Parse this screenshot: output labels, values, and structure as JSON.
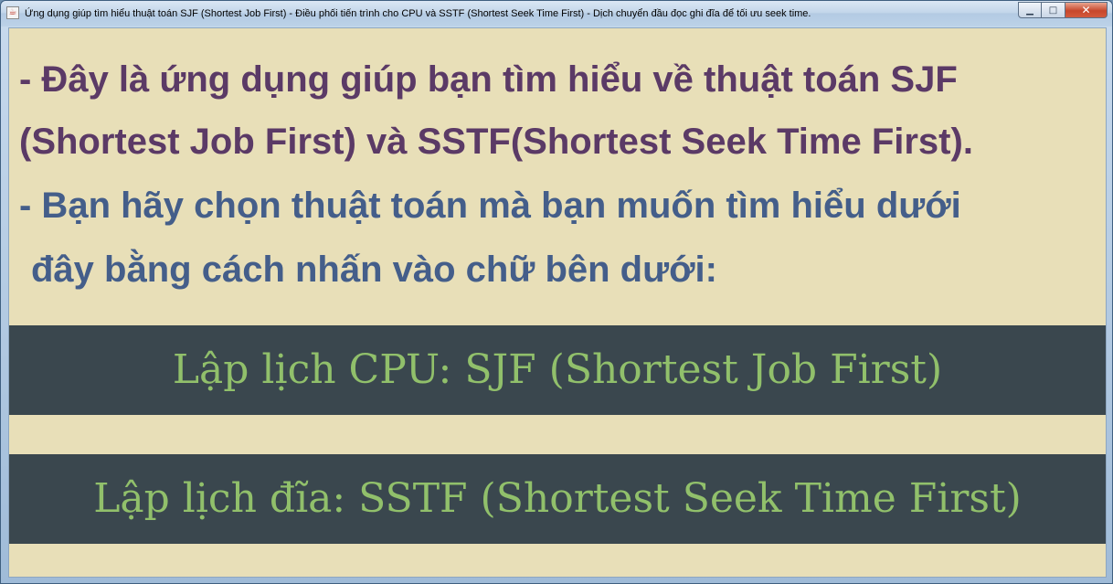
{
  "window": {
    "title": "Ứng dụng giúp tìm hiểu thuật toán SJF (Shortest Job First) - Điều phối tiến trình cho CPU và SSTF (Shortest Seek Time First) - Dịch chuyển đầu đọc ghi đĩa để tối ưu seek time.",
    "icon": "java-app-icon",
    "controls": {
      "minimize": "minimize-icon",
      "maximize": "maximize-icon",
      "close": "close-icon"
    }
  },
  "intro": {
    "line1": "- Đây là ứng dụng giúp bạn tìm hiểu về thuật toán SJF",
    "line2": "(Shortest Job First) và SSTF(Shortest Seek Time First).",
    "line3": "- Bạn hãy chọn thuật toán mà bạn muốn tìm hiểu dưới",
    "line4": "đây bằng cách nhấn vào chữ bên dưới:"
  },
  "options": {
    "cpu_label": "Lập lịch CPU: SJF (Shortest Job First)",
    "disk_label": "Lập lịch đĩa: SSTF (Shortest Seek Time First)"
  },
  "colors": {
    "background": "#e8dfb8",
    "heading_purple": "#5b3a66",
    "heading_blue": "#445e8a",
    "button_bg": "#3a474e",
    "button_text": "#91c06b"
  }
}
